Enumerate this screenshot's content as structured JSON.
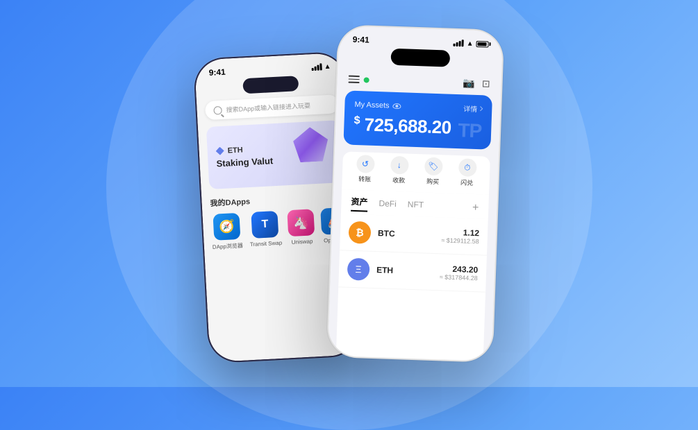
{
  "background": {
    "color_start": "#3b82f6",
    "color_end": "#93c5fd"
  },
  "phone_left": {
    "status_bar": {
      "time": "9:41",
      "signal": "full",
      "wifi": true
    },
    "search_placeholder": "搜索DApp或输入链接进入玩耍",
    "banner": {
      "coin": "ETH",
      "subtitle": "Staking Valut"
    },
    "dapps_title": "我的DApps",
    "dapps": [
      {
        "label": "DApp浏览器",
        "icon": "🧭",
        "class": "dapp-icon-browser"
      },
      {
        "label": "Transit Swap",
        "icon": "🔵",
        "class": "dapp-icon-transit"
      },
      {
        "label": "Uniswap",
        "icon": "🦄",
        "class": "dapp-icon-uniswap"
      },
      {
        "label": "OpenSea",
        "icon": "⛵",
        "class": "dapp-icon-opensea"
      }
    ]
  },
  "phone_right": {
    "status_bar": {
      "time": "9:41",
      "signal": "full",
      "wifi": true,
      "battery": "full"
    },
    "header": {
      "dot_color": "#22c55e"
    },
    "assets_card": {
      "label": "My Assets",
      "detail": "详情",
      "amount": "725,688.20",
      "currency_symbol": "$",
      "watermark": "TP"
    },
    "actions": [
      {
        "label": "转账",
        "icon": "↺"
      },
      {
        "label": "收款",
        "icon": "↓"
      },
      {
        "label": "购买",
        "icon": "🏷"
      },
      {
        "label": "闪兑",
        "icon": "⏱"
      }
    ],
    "tabs": [
      {
        "label": "资产",
        "active": true
      },
      {
        "label": "DeFi",
        "active": false
      },
      {
        "label": "NFT",
        "active": false
      }
    ],
    "assets": [
      {
        "name": "BTC",
        "amount": "1.12",
        "usd": "≈ $129112.58",
        "icon": "₿",
        "icon_class": "btc-icon"
      },
      {
        "name": "ETH",
        "amount": "243.20",
        "usd": "≈ $317844.28",
        "icon": "Ξ",
        "icon_class": "eth-icon-circle"
      }
    ]
  }
}
